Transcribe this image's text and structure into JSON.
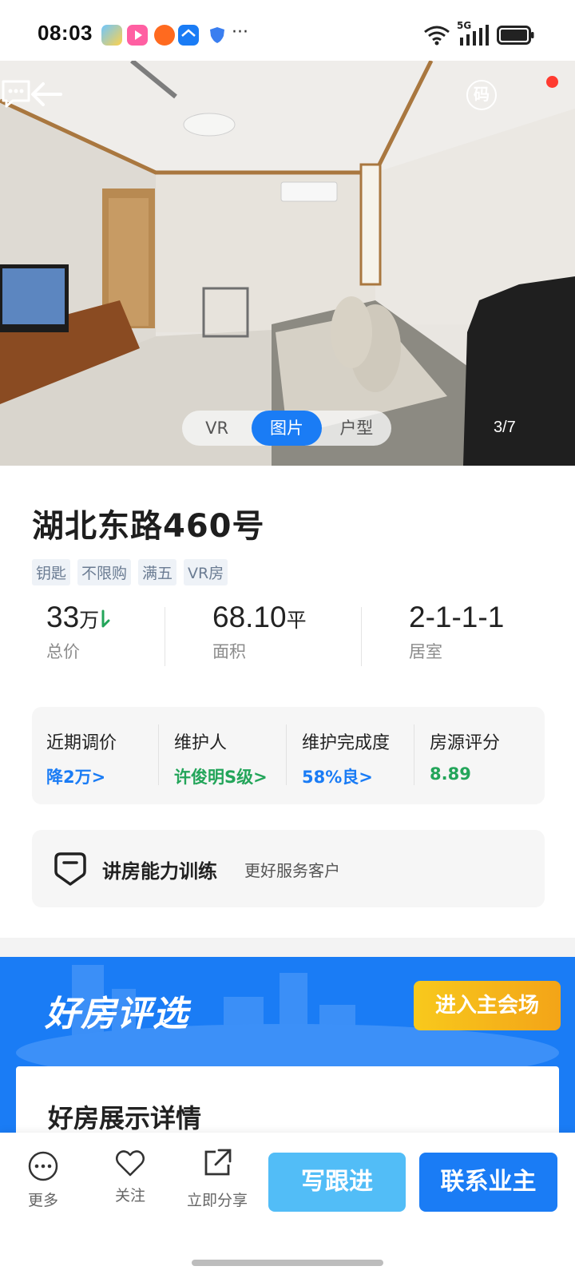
{
  "status_bar": {
    "time": "08:03",
    "network": "5G",
    "more": "···"
  },
  "gallery": {
    "tabs": [
      {
        "label": "VR",
        "active": false
      },
      {
        "label": "图片",
        "active": true
      },
      {
        "label": "户型",
        "active": false
      }
    ],
    "counter": "3/7",
    "qr_label": "码",
    "icons": [
      "back-arrow-icon",
      "qr-code-icon",
      "message-icon"
    ]
  },
  "listing": {
    "title": "湖北东路460号",
    "tags": [
      "钥匙",
      "不限购",
      "满五",
      "VR房"
    ],
    "stats": {
      "price": {
        "value": "33",
        "unit": "万",
        "label": "总价",
        "trend": "down"
      },
      "area": {
        "value": "68.10",
        "unit": "平",
        "label": "面积"
      },
      "rooms": {
        "value": "2-1-1-1",
        "label": "居室"
      }
    }
  },
  "info": {
    "items": [
      {
        "label": "近期调价",
        "value": "降2万>",
        "color": "#1a7cf5"
      },
      {
        "label": "维护人",
        "value": "许俊明S级>",
        "color": "#23a55a"
      },
      {
        "label": "维护完成度",
        "value": "58%良>",
        "color": "#1a7cf5"
      },
      {
        "label": "房源评分",
        "value": "8.89",
        "color": "#23a55a"
      }
    ]
  },
  "training": {
    "title": "讲房能力训练",
    "subtitle": "更好服务客户"
  },
  "promo": {
    "title": "好房评选",
    "button": "进入主会场",
    "detail_title": "好房展示详情"
  },
  "bottom_bar": {
    "more": "更多",
    "follow": "关注",
    "share": "立即分享",
    "write_followup": "写跟进",
    "contact_owner": "联系业主"
  },
  "colors": {
    "accent_blue": "#1a7cf5",
    "light_blue": "#52bdf7",
    "green": "#23a55a",
    "gold": "#f8c91c"
  }
}
